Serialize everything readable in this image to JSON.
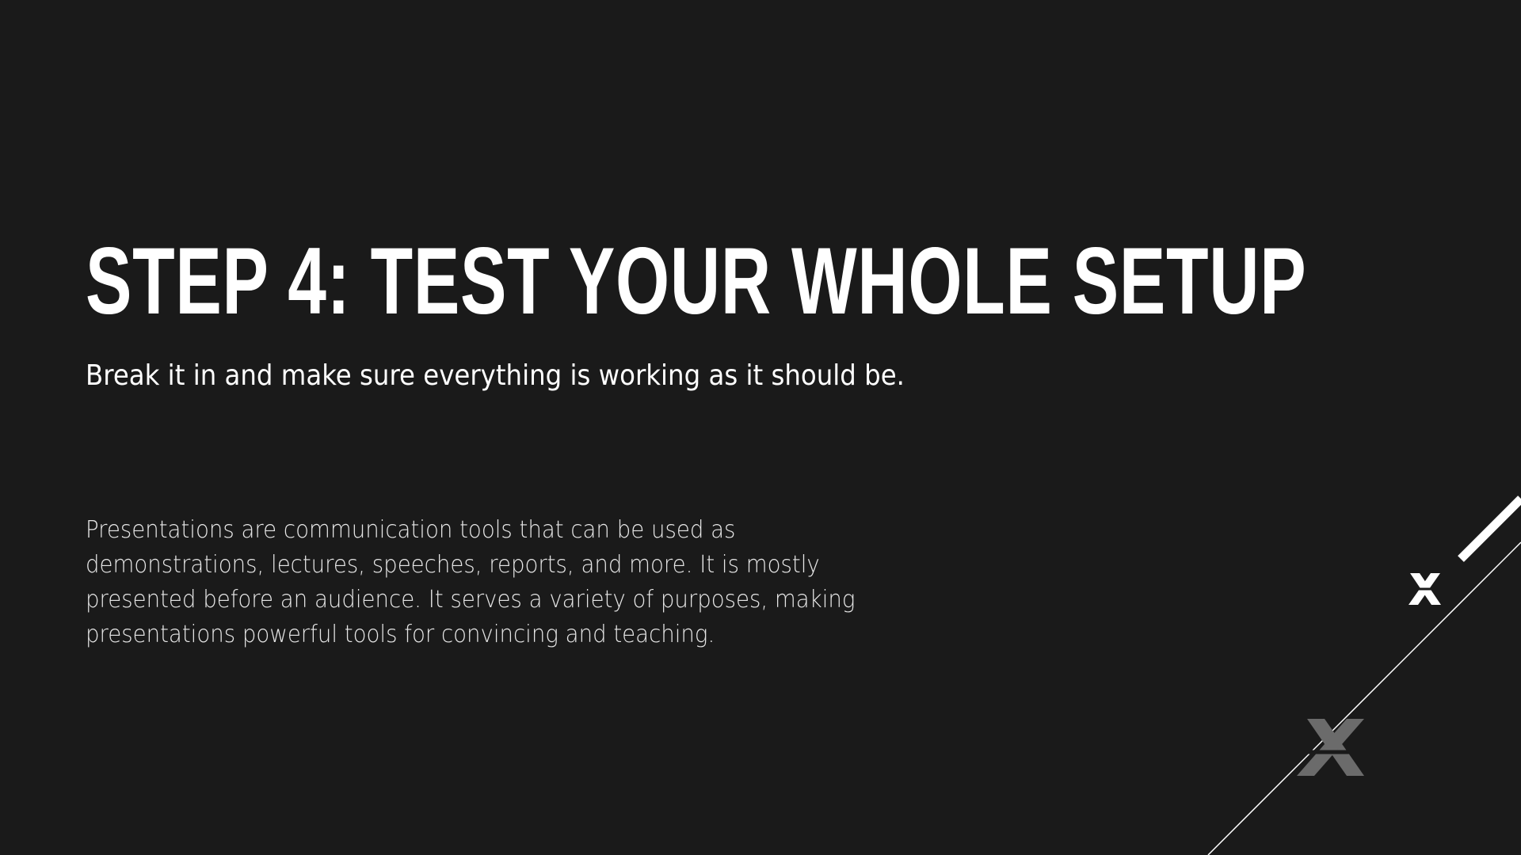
{
  "slide": {
    "title": "STEP 4: TEST YOUR WHOLE SETUP",
    "subtitle": "Break it in and make sure everything is working as it should be.",
    "body": "Presentations are communication tools that can be used as demonstrations, lectures, speeches, reports, and more. It is mostly presented before an audience. It serves a variety of purposes, making presentations powerful tools for convincing and teaching."
  },
  "colors": {
    "background": "#1a1a1a",
    "text": "#ffffff",
    "body_text": "#e6e6e6",
    "logo_bright": "#ffffff",
    "logo_dim": "#6b6b6b"
  },
  "decorations": {
    "logo_icon": "stylized-x-logo-icon",
    "stripe": "diagonal-stripe",
    "line": "diagonal-line"
  }
}
